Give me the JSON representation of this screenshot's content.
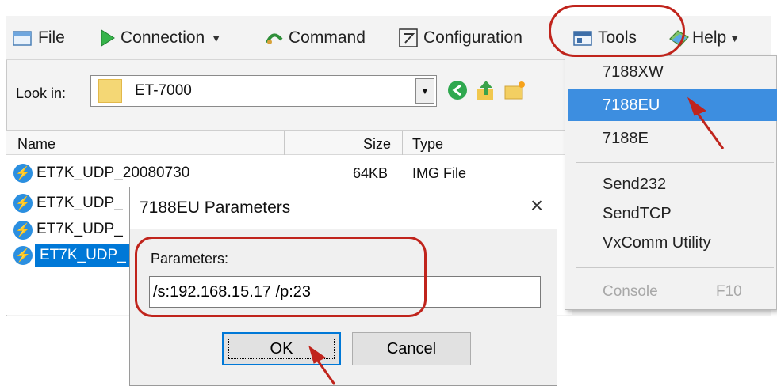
{
  "menubar": {
    "file": "File",
    "connection": "Connection",
    "command": "Command",
    "configuration": "Configuration",
    "tools": "Tools",
    "help": "Help"
  },
  "lookin": {
    "label": "Look in:",
    "value": "ET-7000"
  },
  "filelist": {
    "headers": {
      "name": "Name",
      "size": "Size",
      "type": "Type"
    },
    "rows": [
      {
        "name": "ET7K_UDP_20080730",
        "size": "64KB",
        "type": "IMG File"
      },
      {
        "name": "ET7K_UDP_"
      },
      {
        "name": "ET7K_UDP_"
      },
      {
        "name": "ET7K_UDP_"
      }
    ]
  },
  "tools_menu": {
    "items": [
      "7188XW",
      "7188EU",
      "7188E",
      "Send232",
      "SendTCP",
      "VxComm Utility"
    ],
    "console": "Console",
    "console_shortcut": "F10",
    "highlighted": "7188EU"
  },
  "dialog": {
    "title": "7188EU Parameters",
    "close": "×",
    "param_label": "Parameters:",
    "param_value": "/s:192.168.15.17 /p:23",
    "ok": "OK",
    "cancel": "Cancel"
  },
  "colors": {
    "annotation": "#c0241c",
    "highlight": "#3d8ee0",
    "selection": "#0078d7"
  },
  "icons": [
    "file-icon",
    "connection-icon",
    "command-icon",
    "configuration-icon",
    "tools-icon",
    "help-icon",
    "folder-icon",
    "back-icon",
    "up-folder-icon",
    "new-folder-icon",
    "img-file-icon",
    "close-icon"
  ]
}
